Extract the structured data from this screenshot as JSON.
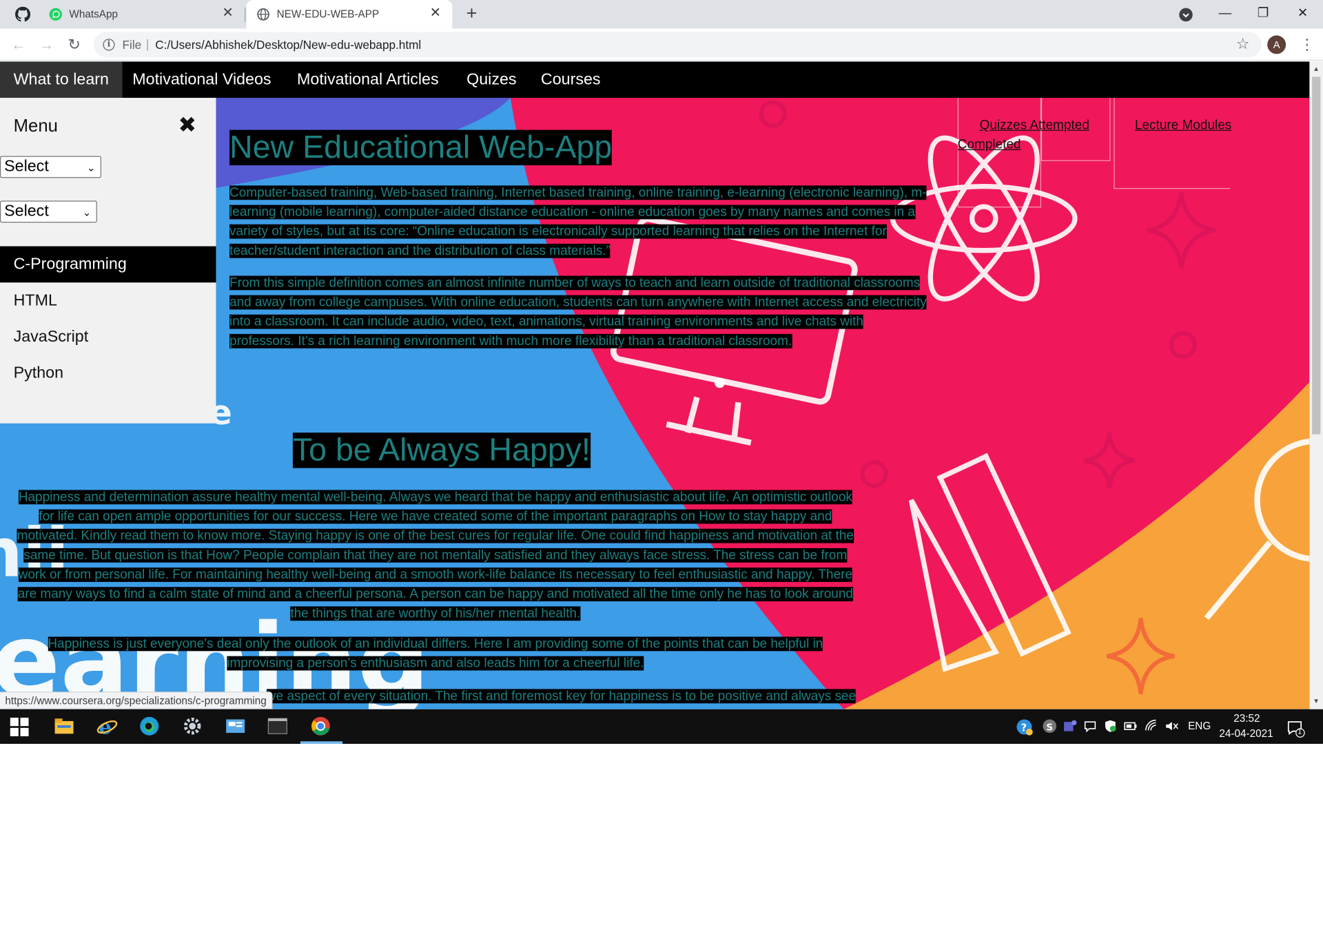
{
  "browser": {
    "tabs": [
      {
        "title": "WhatsApp",
        "active": false
      },
      {
        "title": "NEW-EDU-WEB-APP",
        "active": true
      }
    ],
    "address": {
      "scheme": "File",
      "url": "C:/Users/Abhishek/Desktop/New-edu-webapp.html"
    },
    "profile_initial": "A",
    "status_url": "https://www.coursera.org/specializations/c-programming"
  },
  "topnav": {
    "items": [
      "What to learn",
      "Motivational Videos",
      "Motivational Articles",
      "Quizes",
      "Courses"
    ],
    "active_index": 0
  },
  "sidebar": {
    "title": "Menu",
    "close_glyph": "✖",
    "select1": "Select",
    "select2": "Select",
    "items": [
      "C-Programming",
      "HTML",
      "JavaScript",
      "Python"
    ],
    "active_index": 0
  },
  "main": {
    "heading": "New Educational Web-App",
    "paragraphs": [
      "Computer-based training, Web-based training, Internet based training, online training, e-learning (electronic learning), m-learning (mobile learning), computer-aided distance education - online education goes by many names and comes in a variety of styles, but at its core: “Online education is electronically supported learning that relies on the Internet for teacher/student interaction and the distribution of class materials.”",
      "From this simple definition comes an almost infinite number of ways to teach and learn outside of traditional classrooms and away from college campuses. With online education, students can turn anywhere with Internet access and electricity into a classroom. It can include audio, video, text, animations, virtual training environments and live chats with professors. It’s a rich learning environment with much more flexibility than a traditional classroom."
    ],
    "heading2": "To be Always Happy!",
    "paragraphs2": [
      "Happiness and determination assure healthy mental well-being. Always we heard that be happy and enthusiastic about life. An optimistic outlook for life can open ample opportunities for our success. Here we have created some of the important paragraphs on How to stay happy and motivated. Kindly read them to know more. Staying happy is one of the best cures for regular life. One could find happiness and motivation at the same time. But question is that How? People complain that they are not mentally satisfied and they always face stress. The stress can be from work or from personal life. For maintaining healthy well-being and a smooth work-life balance its necessary to feel enthusiastic and happy. There are many ways to find a calm state of mind and a cheerful persona. A person can be happy and motivated all the time only he has to look around the things that are worthy of his/her mental health.",
      "Happiness is just everyone’s deal only the outlook of an individual differs. Here I am providing some of the points that can be helpful in improvising a person’s enthusiasm and also leads him for a cheerful life.",
      "ive aspect of every situation. The first and foremost key for happiness is to be positive and always see"
    ]
  },
  "right_panel": {
    "quizzes_attempted": "Quizzes Attempted",
    "completed": "Completed",
    "lecture_modules": "Lecture Modules"
  },
  "taskbar": {
    "language": "ENG",
    "time": "23:52",
    "date": "24-04-2021",
    "notification_count": "1"
  },
  "colors": {
    "text_teal": "#1e7f80",
    "nav_black": "#000000",
    "sidebar_bg": "#f1f1f1",
    "bg_pink": "#f0185a",
    "bg_blue": "#3d9de6",
    "bg_orange": "#f7a23a"
  }
}
